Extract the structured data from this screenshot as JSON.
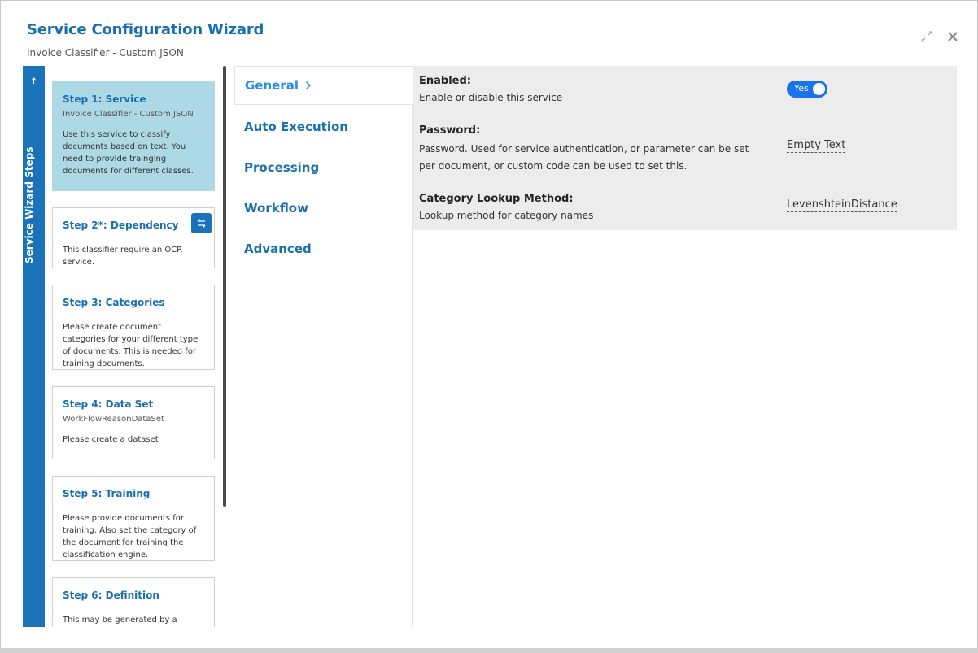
{
  "header": {
    "title": "Service Configuration Wizard",
    "subtitle": "Invoice Classifier - Custom JSON"
  },
  "steps_bar": {
    "label": "Service Wizard Steps"
  },
  "steps": [
    {
      "title": "Step 1: Service",
      "subtitle": "Invoice Classifier - Custom JSON",
      "description": "Use this service to classify documents based on text. You need to provide trainging documents for different classes."
    },
    {
      "title": "Step 2*: Dependency",
      "subtitle": "",
      "description": "This classifier require an OCR service."
    },
    {
      "title": "Step 3: Categories",
      "subtitle": "",
      "description": "Please create document categories for your different type of documents. This is needed for training documents."
    },
    {
      "title": "Step 4: Data Set",
      "subtitle": "WorkFlowReasonDataSet",
      "description": "Please create a dataset"
    },
    {
      "title": "Step 5: Training",
      "subtitle": "",
      "description": "Please provide documents for training. Also set the category of the document for training the classification engine."
    },
    {
      "title": "Step 6: Definition",
      "subtitle": "",
      "description": "This may be generated by a previous"
    }
  ],
  "tabs": [
    {
      "label": "General"
    },
    {
      "label": "Auto Execution"
    },
    {
      "label": "Processing"
    },
    {
      "label": "Workflow"
    },
    {
      "label": "Advanced"
    }
  ],
  "properties": {
    "enabled": {
      "label": "Enabled:",
      "description": "Enable or disable this service",
      "toggle_label": "Yes"
    },
    "password": {
      "label": "Password:",
      "description": "Password. Used for service authentication, or parameter can be set per document, or custom code can be used to set this.",
      "value": "Empty Text"
    },
    "category_lookup": {
      "label": "Category Lookup Method:",
      "description": "Lookup method for category names",
      "value": "LevenshteinDistance"
    }
  },
  "colors": {
    "accent": "#1a73b9",
    "title": "#1a6fad",
    "active_step": "#add8e6",
    "toggle": "#1a73e8"
  }
}
